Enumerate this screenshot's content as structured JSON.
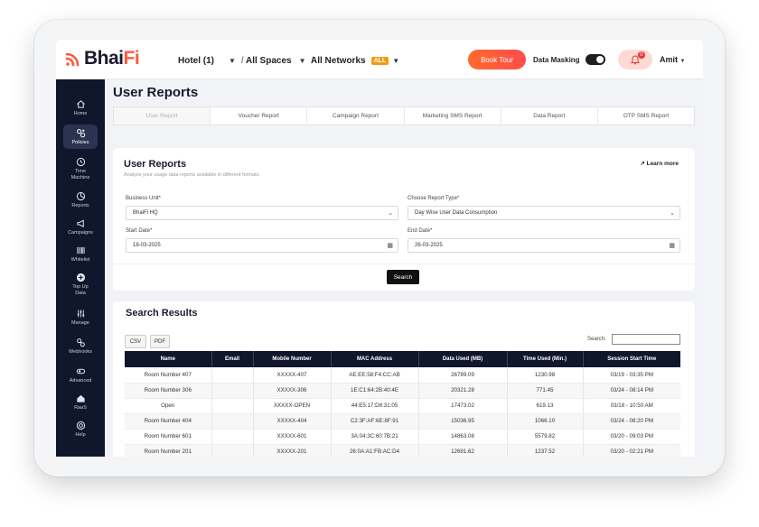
{
  "brand": {
    "name_main": "Bhai",
    "name_accent": "Fi",
    "accent_color": "#ff5a3c"
  },
  "header": {
    "hotel_selector": "Hotel (1)",
    "spaces_selector": "All Spaces",
    "networks_selector": "All Networks",
    "networks_badge": "ALL",
    "book_tour": "Book Tour",
    "data_masking": "Data Masking",
    "notification_count": "0",
    "user": "Amit"
  },
  "sidebar": {
    "items": [
      {
        "label": "Home",
        "icon": "home-icon"
      },
      {
        "label": "Policies",
        "icon": "policies-icon"
      },
      {
        "label": "Time",
        "label2": "Machine",
        "icon": "clock-icon"
      },
      {
        "label": "Reports",
        "icon": "reports-icon"
      },
      {
        "label": "Campaigns",
        "icon": "megaphone-icon"
      },
      {
        "label": "Whitelist",
        "icon": "barcode-icon"
      },
      {
        "label": "Top Up",
        "label2": "Data",
        "icon": "plus-circle-icon"
      },
      {
        "label": "Manage",
        "icon": "sliders-icon"
      },
      {
        "label": "Webhooks",
        "icon": "webhook-icon"
      },
      {
        "label": "Advanced",
        "icon": "advanced-icon"
      },
      {
        "label": "RaaS",
        "icon": "building-icon"
      },
      {
        "label": "Help",
        "icon": "help-icon"
      }
    ]
  },
  "page": {
    "title": "User Reports"
  },
  "tabs": [
    "User Report",
    "Voucher Report",
    "Campaign Report",
    "Marketing SMS Report",
    "Data Report",
    "OTP SMS Report"
  ],
  "form": {
    "title": "User Reports",
    "subtitle": "Analyze your usage data reports available in different formats.",
    "learn_more": "Learn more",
    "business_unit_label": "Business Unit*",
    "business_unit_value": "BhaiFi HQ",
    "report_type_label": "Choose Report Type*",
    "report_type_value": "Day Wise User Data Consumption",
    "start_date_label": "Start Date*",
    "start_date_value": "18-03-2025",
    "end_date_label": "End Date*",
    "end_date_value": "26-03-2025",
    "search_button": "Search"
  },
  "results": {
    "title": "Search Results",
    "csv": "CSV",
    "pdf": "PDF",
    "search_label": "Search:",
    "columns": [
      "Name",
      "Email",
      "Mobile Number",
      "MAC Address",
      "Data Used (MB)",
      "Time Used (Min.)",
      "Session Start Time"
    ],
    "rows": [
      [
        "Room Number 407",
        "",
        "XXXXX-407",
        "AE:EE:58:F4:CC:AB",
        "26789.09",
        "1230.98",
        "03/19 - 03:35 PM"
      ],
      [
        "Room Number 306",
        "",
        "XXXXX-306",
        "1E:C1:64:2B:40:4E",
        "20321.28",
        "771.45",
        "03/24 - 08:14 PM"
      ],
      [
        "Open",
        "",
        "XXXXX-OPEN",
        "44:E5:17:D8:31:05",
        "17473.02",
        "619.13",
        "03/18 - 10:50 AM"
      ],
      [
        "Room Number 404",
        "",
        "XXXXX-404",
        "C2:3F:AF:6E:8F:91",
        "15036.95",
        "1066.10",
        "03/24 - 08:20 PM"
      ],
      [
        "Room Number 601",
        "",
        "XXXXX-601",
        "3A:04:3C:60:7B:21",
        "14863.08",
        "5579.82",
        "03/20 - 09:03 PM"
      ],
      [
        "Room Number 201",
        "",
        "XXXXX-201",
        "26:0A:A1:FB:AC:D4",
        "12691.62",
        "1237.52",
        "03/20 - 02:21 PM"
      ]
    ]
  }
}
